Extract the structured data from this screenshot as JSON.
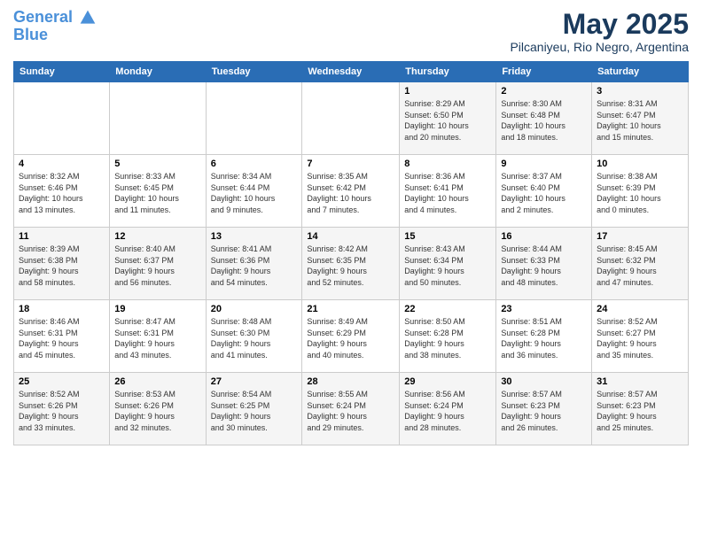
{
  "header": {
    "logo_line1": "General",
    "logo_line2": "Blue",
    "month": "May 2025",
    "location": "Pilcaniyeu, Rio Negro, Argentina"
  },
  "days_of_week": [
    "Sunday",
    "Monday",
    "Tuesday",
    "Wednesday",
    "Thursday",
    "Friday",
    "Saturday"
  ],
  "weeks": [
    [
      {
        "day": "",
        "info": ""
      },
      {
        "day": "",
        "info": ""
      },
      {
        "day": "",
        "info": ""
      },
      {
        "day": "",
        "info": ""
      },
      {
        "day": "1",
        "info": "Sunrise: 8:29 AM\nSunset: 6:50 PM\nDaylight: 10 hours\nand 20 minutes."
      },
      {
        "day": "2",
        "info": "Sunrise: 8:30 AM\nSunset: 6:48 PM\nDaylight: 10 hours\nand 18 minutes."
      },
      {
        "day": "3",
        "info": "Sunrise: 8:31 AM\nSunset: 6:47 PM\nDaylight: 10 hours\nand 15 minutes."
      }
    ],
    [
      {
        "day": "4",
        "info": "Sunrise: 8:32 AM\nSunset: 6:46 PM\nDaylight: 10 hours\nand 13 minutes."
      },
      {
        "day": "5",
        "info": "Sunrise: 8:33 AM\nSunset: 6:45 PM\nDaylight: 10 hours\nand 11 minutes."
      },
      {
        "day": "6",
        "info": "Sunrise: 8:34 AM\nSunset: 6:44 PM\nDaylight: 10 hours\nand 9 minutes."
      },
      {
        "day": "7",
        "info": "Sunrise: 8:35 AM\nSunset: 6:42 PM\nDaylight: 10 hours\nand 7 minutes."
      },
      {
        "day": "8",
        "info": "Sunrise: 8:36 AM\nSunset: 6:41 PM\nDaylight: 10 hours\nand 4 minutes."
      },
      {
        "day": "9",
        "info": "Sunrise: 8:37 AM\nSunset: 6:40 PM\nDaylight: 10 hours\nand 2 minutes."
      },
      {
        "day": "10",
        "info": "Sunrise: 8:38 AM\nSunset: 6:39 PM\nDaylight: 10 hours\nand 0 minutes."
      }
    ],
    [
      {
        "day": "11",
        "info": "Sunrise: 8:39 AM\nSunset: 6:38 PM\nDaylight: 9 hours\nand 58 minutes."
      },
      {
        "day": "12",
        "info": "Sunrise: 8:40 AM\nSunset: 6:37 PM\nDaylight: 9 hours\nand 56 minutes."
      },
      {
        "day": "13",
        "info": "Sunrise: 8:41 AM\nSunset: 6:36 PM\nDaylight: 9 hours\nand 54 minutes."
      },
      {
        "day": "14",
        "info": "Sunrise: 8:42 AM\nSunset: 6:35 PM\nDaylight: 9 hours\nand 52 minutes."
      },
      {
        "day": "15",
        "info": "Sunrise: 8:43 AM\nSunset: 6:34 PM\nDaylight: 9 hours\nand 50 minutes."
      },
      {
        "day": "16",
        "info": "Sunrise: 8:44 AM\nSunset: 6:33 PM\nDaylight: 9 hours\nand 48 minutes."
      },
      {
        "day": "17",
        "info": "Sunrise: 8:45 AM\nSunset: 6:32 PM\nDaylight: 9 hours\nand 47 minutes."
      }
    ],
    [
      {
        "day": "18",
        "info": "Sunrise: 8:46 AM\nSunset: 6:31 PM\nDaylight: 9 hours\nand 45 minutes."
      },
      {
        "day": "19",
        "info": "Sunrise: 8:47 AM\nSunset: 6:31 PM\nDaylight: 9 hours\nand 43 minutes."
      },
      {
        "day": "20",
        "info": "Sunrise: 8:48 AM\nSunset: 6:30 PM\nDaylight: 9 hours\nand 41 minutes."
      },
      {
        "day": "21",
        "info": "Sunrise: 8:49 AM\nSunset: 6:29 PM\nDaylight: 9 hours\nand 40 minutes."
      },
      {
        "day": "22",
        "info": "Sunrise: 8:50 AM\nSunset: 6:28 PM\nDaylight: 9 hours\nand 38 minutes."
      },
      {
        "day": "23",
        "info": "Sunrise: 8:51 AM\nSunset: 6:28 PM\nDaylight: 9 hours\nand 36 minutes."
      },
      {
        "day": "24",
        "info": "Sunrise: 8:52 AM\nSunset: 6:27 PM\nDaylight: 9 hours\nand 35 minutes."
      }
    ],
    [
      {
        "day": "25",
        "info": "Sunrise: 8:52 AM\nSunset: 6:26 PM\nDaylight: 9 hours\nand 33 minutes."
      },
      {
        "day": "26",
        "info": "Sunrise: 8:53 AM\nSunset: 6:26 PM\nDaylight: 9 hours\nand 32 minutes."
      },
      {
        "day": "27",
        "info": "Sunrise: 8:54 AM\nSunset: 6:25 PM\nDaylight: 9 hours\nand 30 minutes."
      },
      {
        "day": "28",
        "info": "Sunrise: 8:55 AM\nSunset: 6:24 PM\nDaylight: 9 hours\nand 29 minutes."
      },
      {
        "day": "29",
        "info": "Sunrise: 8:56 AM\nSunset: 6:24 PM\nDaylight: 9 hours\nand 28 minutes."
      },
      {
        "day": "30",
        "info": "Sunrise: 8:57 AM\nSunset: 6:23 PM\nDaylight: 9 hours\nand 26 minutes."
      },
      {
        "day": "31",
        "info": "Sunrise: 8:57 AM\nSunset: 6:23 PM\nDaylight: 9 hours\nand 25 minutes."
      }
    ]
  ]
}
